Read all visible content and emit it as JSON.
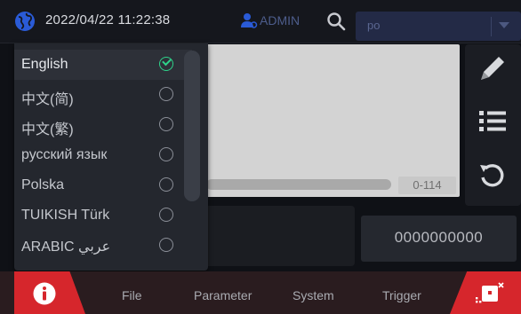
{
  "header": {
    "datetime": "2022/04/22 11:22:38",
    "user": "ADMIN",
    "search_value": "po",
    "icons": [
      "globe-icon",
      "user-icon",
      "search-icon",
      "dropdown-arrow-icon"
    ]
  },
  "language_menu": {
    "selected": "English",
    "items": [
      {
        "label": "English",
        "selected": true
      },
      {
        "label": "中文(简)",
        "selected": false
      },
      {
        "label": "中文(繁)",
        "selected": false
      },
      {
        "label": "русский язык",
        "selected": false
      },
      {
        "label": "Polska",
        "selected": false
      },
      {
        "label": "TUIKISH Türk",
        "selected": false
      },
      {
        "label": "ARABIC عربي",
        "selected": false
      }
    ]
  },
  "preview": {
    "range": "0-114"
  },
  "counter": "0000000000",
  "toolbar": {
    "icons": [
      "edit-icon",
      "list-icon",
      "reset-icon"
    ]
  },
  "nav": {
    "items": [
      "File",
      "Parameter",
      "System",
      "Trigger"
    ],
    "left_icon": "info-icon",
    "right_icon": "alarm-icon"
  },
  "colors": {
    "accent_red": "#d6262c",
    "selected_green": "#2fd28a",
    "header_blue": "#2a5bd7"
  }
}
